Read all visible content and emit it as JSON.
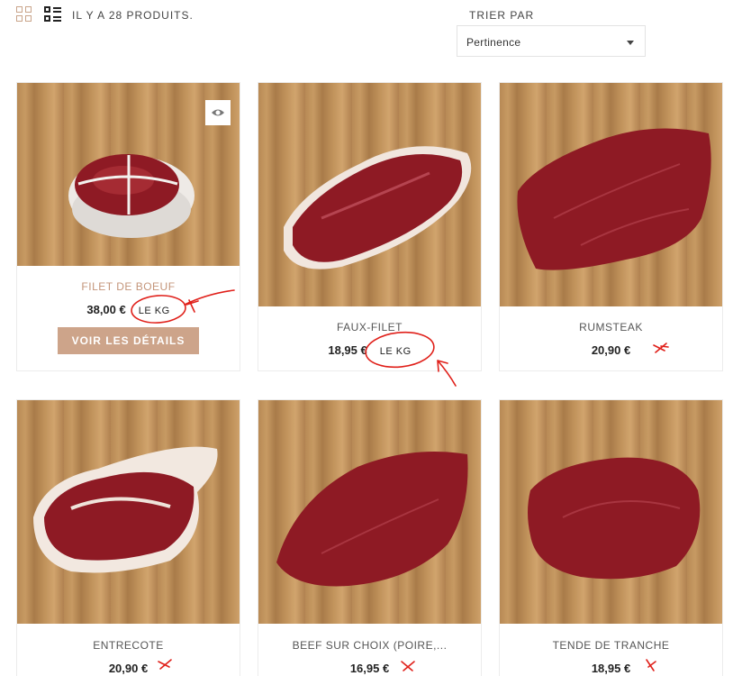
{
  "toolbar": {
    "count_text": "IL Y A 28 PRODUITS.",
    "sort_label": "TRIER PAR",
    "sort_value": "Pertinence",
    "grid_icon": "grid-view-icon",
    "list_icon": "list-view-icon"
  },
  "products": [
    {
      "name": "FILET DE BOEUF",
      "price": "38,00 €",
      "unit": "LE KG",
      "button": "VOIR LES DÉTAILS",
      "name_color": "#c4957a"
    },
    {
      "name": "FAUX-FILET",
      "price": "18,95 €",
      "unit": "LE KG"
    },
    {
      "name": "RUMSTEAK",
      "price": "20,90 €",
      "unit": ""
    },
    {
      "name": "ENTRECOTE",
      "price": "20,90 €",
      "unit": ""
    },
    {
      "name": "BEEF SUR CHOIX (POIRE,...",
      "price": "16,95 €",
      "unit": ""
    },
    {
      "name": "TENDE DE TRANCHE",
      "price": "18,95 €",
      "unit": ""
    }
  ],
  "colors": {
    "accent": "#cda48a",
    "annotation": "#e0201a",
    "meat": "#8e1a24"
  }
}
